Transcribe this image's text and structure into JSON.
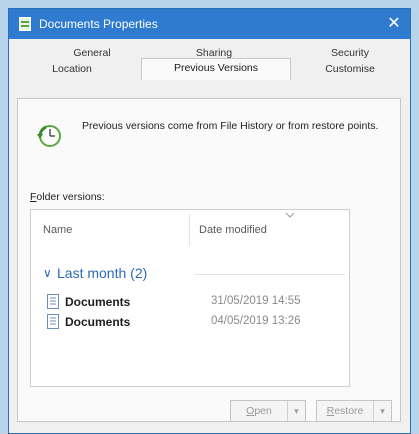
{
  "window": {
    "title": "Documents Properties",
    "close_glyph": "✕"
  },
  "tabs": {
    "row1": [
      "General",
      "Sharing",
      "Security"
    ],
    "row2": [
      "Location",
      "Previous Versions",
      "Customise"
    ],
    "active": "Previous Versions"
  },
  "info": {
    "icon": "history-clock-icon",
    "text": "Previous versions come from File History or from restore points."
  },
  "folder_versions": {
    "label_accel": "F",
    "label_rest": "older versions:"
  },
  "list": {
    "columns": [
      "Name",
      "Date modified"
    ],
    "group": {
      "chevron": "∨",
      "label": "Last month (2)"
    },
    "rows": [
      {
        "name": "Documents",
        "date": "31/05/2019 14:55"
      },
      {
        "name": "Documents",
        "date": "04/05/2019 13:26"
      }
    ]
  },
  "buttons": {
    "open": {
      "accel": "O",
      "rest": "pen",
      "arrow": "▾"
    },
    "restore": {
      "accel": "R",
      "rest": "estore",
      "arrow": "▾"
    }
  },
  "colors": {
    "titlebar": "#2e7bd0",
    "accent_blue": "#2a6bb3",
    "background": "#b8d3ec"
  }
}
